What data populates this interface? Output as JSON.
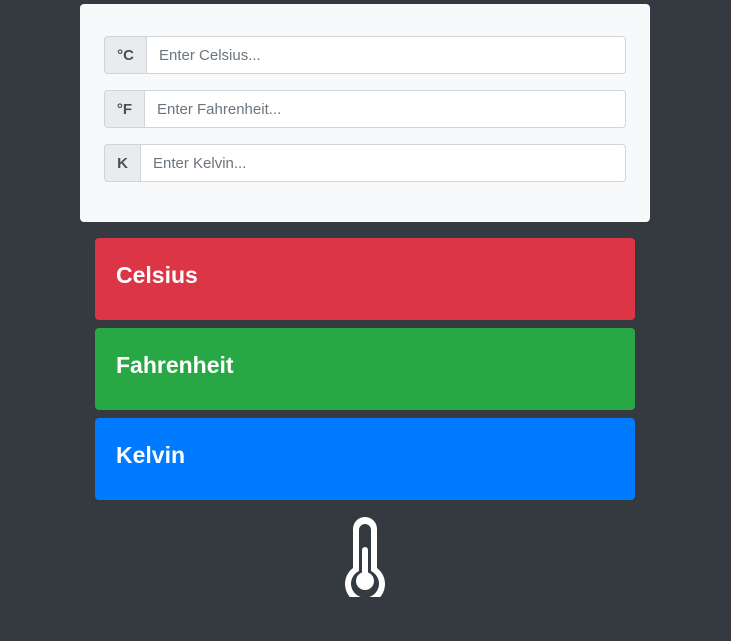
{
  "inputs": {
    "celsius": {
      "unit": "°C",
      "placeholder": "Enter Celsius...",
      "value": ""
    },
    "fahrenheit": {
      "unit": "°F",
      "placeholder": "Enter Fahrenheit...",
      "value": ""
    },
    "kelvin": {
      "unit": "K",
      "placeholder": "Enter Kelvin...",
      "value": ""
    }
  },
  "results": {
    "celsius": {
      "label": "Celsius",
      "color": "#dc3545"
    },
    "fahrenheit": {
      "label": "Fahrenheit",
      "color": "#28a745"
    },
    "kelvin": {
      "label": "Kelvin",
      "color": "#007bff"
    }
  },
  "footer": {
    "icon": "thermometer-icon"
  },
  "theme": {
    "background": "#343a40",
    "card": "#f8f9fa"
  }
}
